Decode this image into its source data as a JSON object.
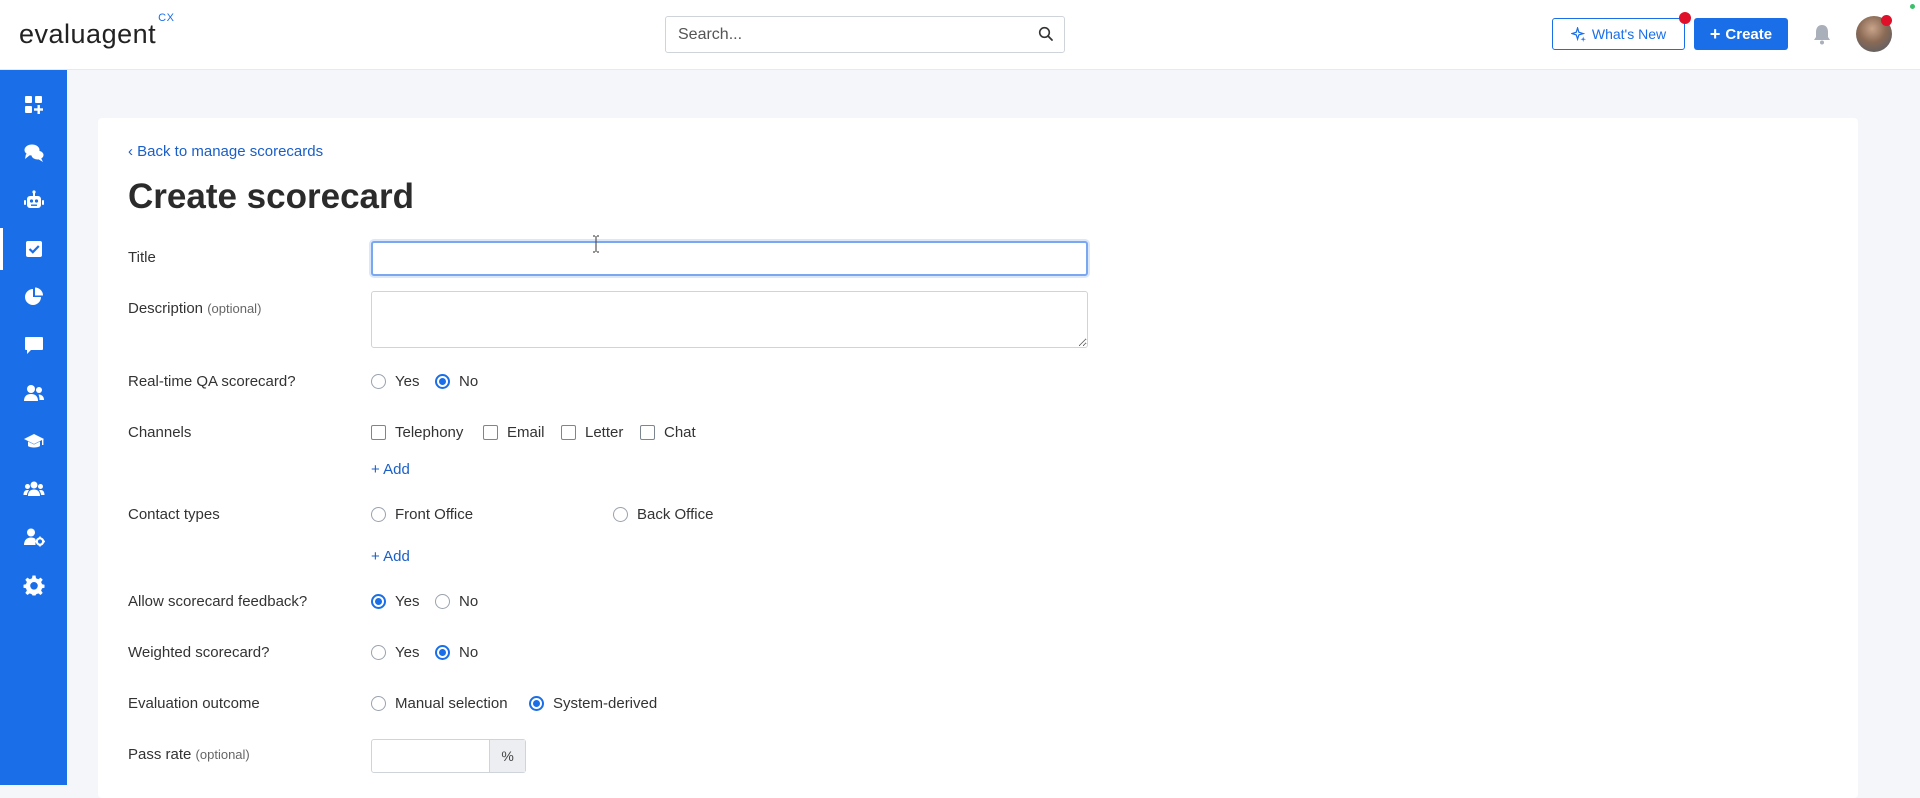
{
  "header": {
    "logo_text": "evaluagent",
    "logo_sup": "CX",
    "search_placeholder": "Search...",
    "whats_new_label": "What's New",
    "create_label": "Create"
  },
  "sidebar": {
    "items": [
      {
        "name": "dashboard"
      },
      {
        "name": "conversations"
      },
      {
        "name": "automation"
      },
      {
        "name": "scorecards",
        "active": true
      },
      {
        "name": "insights"
      },
      {
        "name": "feedback"
      },
      {
        "name": "users"
      },
      {
        "name": "learning"
      },
      {
        "name": "teams"
      },
      {
        "name": "user-settings"
      },
      {
        "name": "settings"
      }
    ]
  },
  "page": {
    "back_link": "Back to manage scorecards",
    "title": "Create scorecard"
  },
  "form": {
    "title_label": "Title",
    "description_label": "Description",
    "description_optional": "(optional)",
    "realtime_label": "Real-time QA scorecard?",
    "realtime_options": [
      "Yes",
      "No"
    ],
    "realtime_selected": "No",
    "channels_label": "Channels",
    "channels": [
      "Telephony",
      "Email",
      "Letter",
      "Chat"
    ],
    "add_label": "+ Add",
    "contact_types_label": "Contact types",
    "contact_types": [
      "Front Office",
      "Back Office"
    ],
    "feedback_label": "Allow scorecard feedback?",
    "feedback_options": [
      "Yes",
      "No"
    ],
    "feedback_selected": "Yes",
    "weighted_label": "Weighted scorecard?",
    "weighted_options": [
      "Yes",
      "No"
    ],
    "weighted_selected": "No",
    "outcome_label": "Evaluation outcome",
    "outcome_options": [
      "Manual selection",
      "System-derived"
    ],
    "outcome_selected": "System-derived",
    "pass_rate_label": "Pass rate",
    "pass_rate_optional": "(optional)",
    "pass_rate_unit": "%"
  },
  "colors": {
    "primary": "#1a6fe8",
    "notification": "#e0102a"
  }
}
